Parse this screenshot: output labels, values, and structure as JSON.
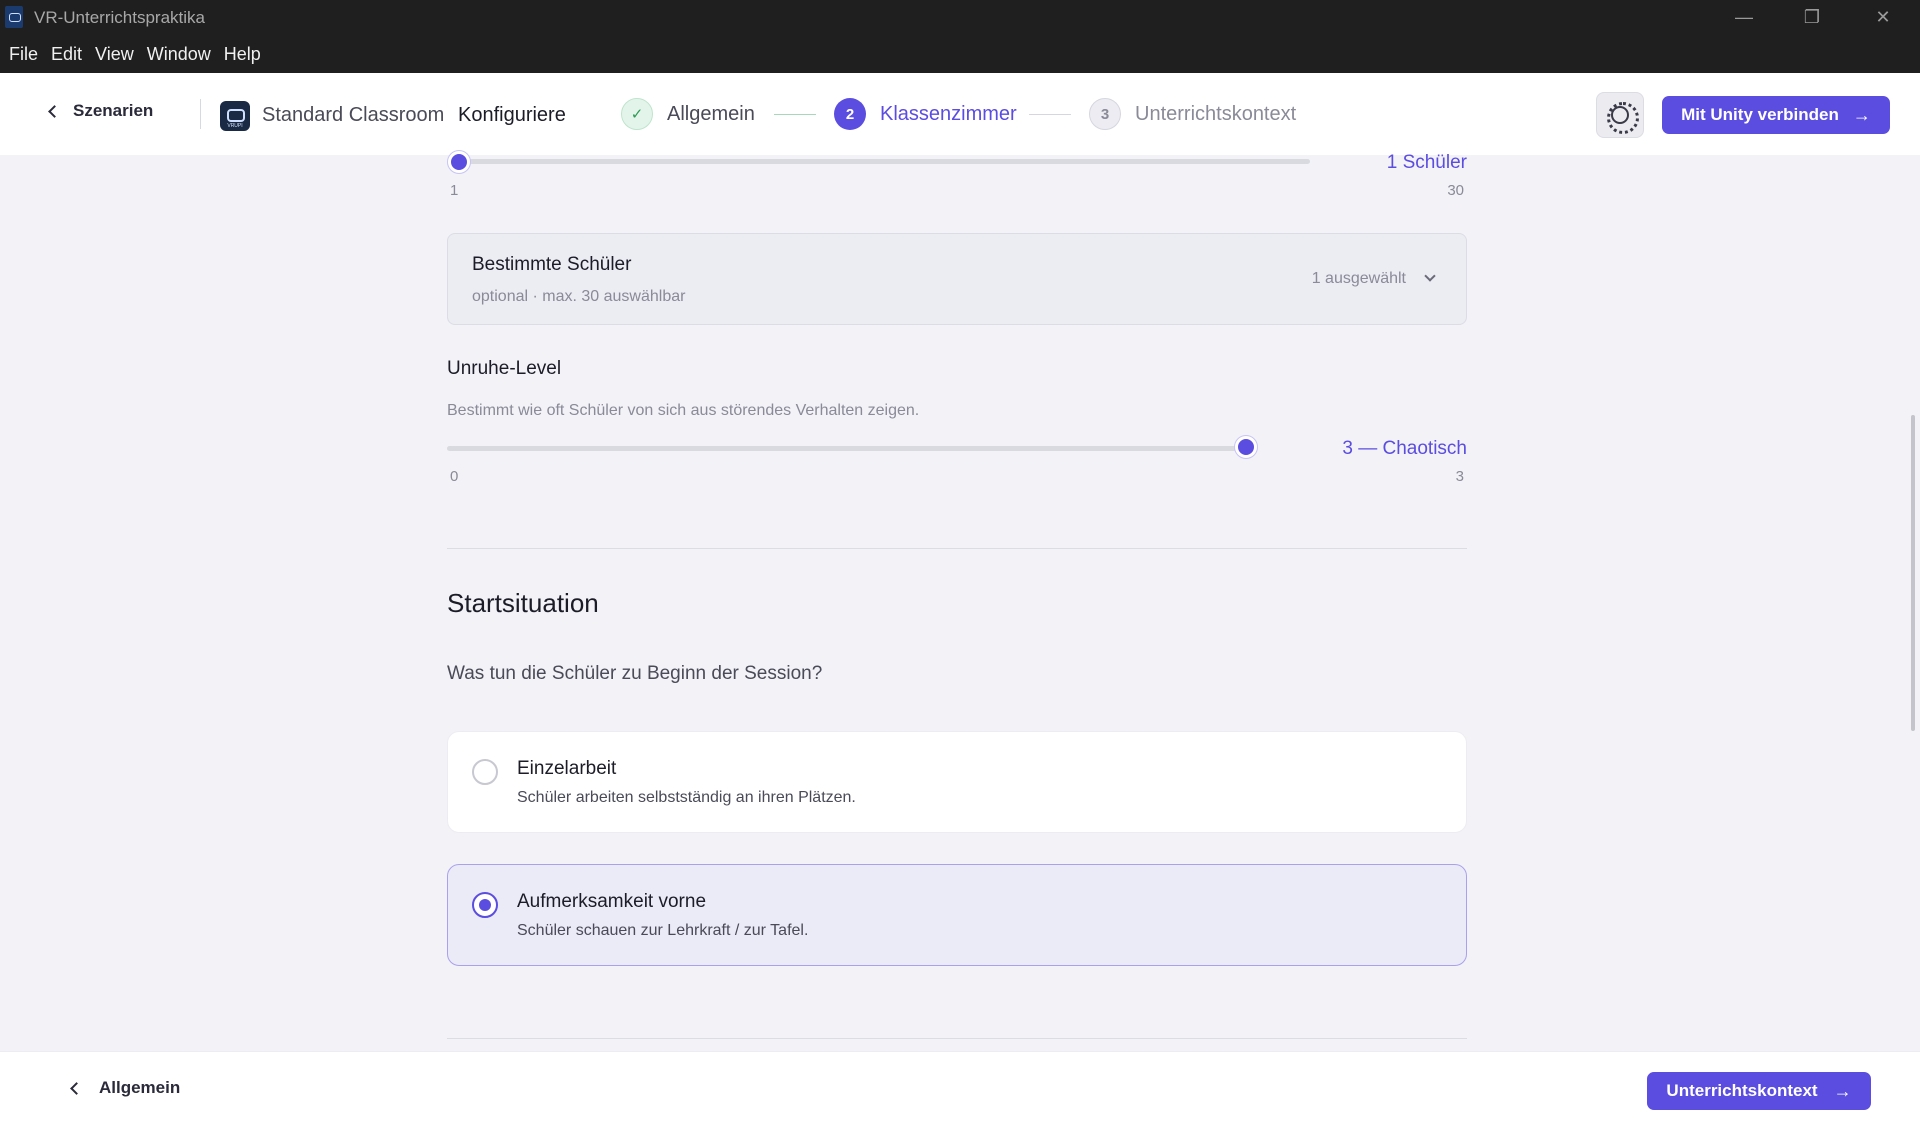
{
  "window": {
    "title": "VR-Unterrichtspraktika",
    "controls": {
      "minimize": "—",
      "maximize": "❐",
      "close": "✕"
    }
  },
  "menu": [
    "File",
    "Edit",
    "View",
    "Window",
    "Help"
  ],
  "header": {
    "back_label": "Szenarien",
    "scenario_name": "Standard Classroom",
    "mode_label": "Konfiguriere",
    "steps": [
      {
        "number": "✓",
        "label": "Allgemein",
        "state": "done"
      },
      {
        "number": "2",
        "label": "Klassenzimmer",
        "state": "active"
      },
      {
        "number": "3",
        "label": "Unterrichtskontext",
        "state": "upcoming"
      }
    ],
    "settings_icon": "gear-icon",
    "unity_button": "Mit Unity verbinden",
    "arrow": "→"
  },
  "students_slider": {
    "value_label": "1 Schüler",
    "value": 1,
    "min": "1",
    "max": "30"
  },
  "specific_students": {
    "title": "Bestimmte Schüler",
    "subtitle": "optional · max. 30 auswählbar",
    "selected": "1 ausgewählt"
  },
  "unrest": {
    "label": "Unruhe-Level",
    "description": "Bestimmt wie oft Schüler von sich aus störendes Verhalten zeigen.",
    "value_label": "3 — Chaotisch",
    "value": 3,
    "min": "0",
    "max": "3"
  },
  "start": {
    "heading": "Startsituation",
    "question": "Was tun die Schüler zu Beginn der Session?",
    "options": [
      {
        "title": "Einzelarbeit",
        "subtitle": "Schüler arbeiten selbstständig an ihren Plätzen.",
        "selected": false
      },
      {
        "title": "Aufmerksamkeit vorne",
        "subtitle": "Schüler schauen zur Lehrkraft / zur Tafel.",
        "selected": true
      }
    ]
  },
  "footer": {
    "back_label": "Allgemein",
    "next_label": "Unterrichtskontext",
    "arrow": "→"
  },
  "colors": {
    "accent": "#5b4de0",
    "success": "#2f9a55"
  }
}
